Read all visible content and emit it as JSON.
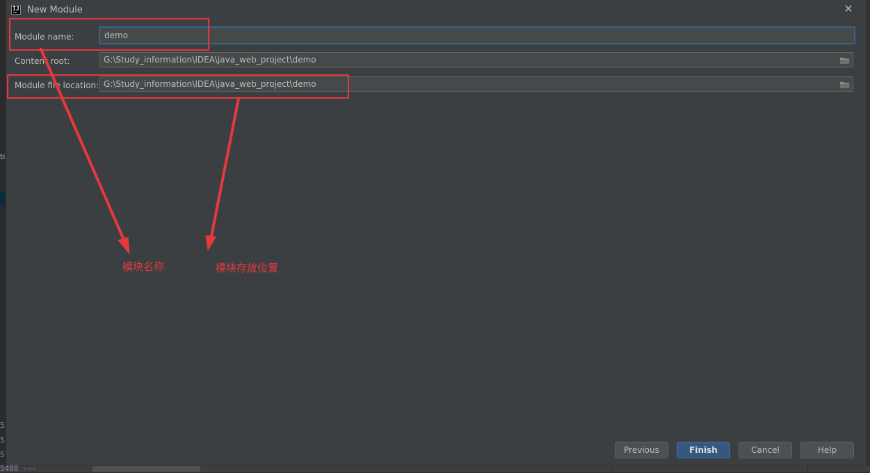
{
  "dialog": {
    "title": "New Module",
    "app_icon_text": "IJ",
    "close_glyph": "✕"
  },
  "form": {
    "module_name": {
      "label": "Module name:",
      "value": "demo"
    },
    "content_root": {
      "label": "Content root:",
      "value": "G:\\Study_information\\IDEA\\java_web_project\\demo"
    },
    "module_file_location": {
      "label": "Module file location:",
      "value": "G:\\Study_information\\IDEA\\java_web_project\\demo"
    }
  },
  "buttons": {
    "previous": "Previous",
    "finish": "Finish",
    "cancel": "Cancel",
    "help": "Help"
  },
  "annotations": {
    "module_name_note": "模块名称",
    "location_note": "模块存放位置",
    "color": "#e5393d"
  },
  "background": {
    "left_fragment": "ti",
    "left_numbers": [
      "5",
      "5",
      "5"
    ],
    "bottom_code": "5408 ---"
  },
  "colors": {
    "dialog_bg": "#3c3f41",
    "field_bg": "#45494a",
    "focus_border": "#3d6185",
    "primary_button": "#365880"
  }
}
